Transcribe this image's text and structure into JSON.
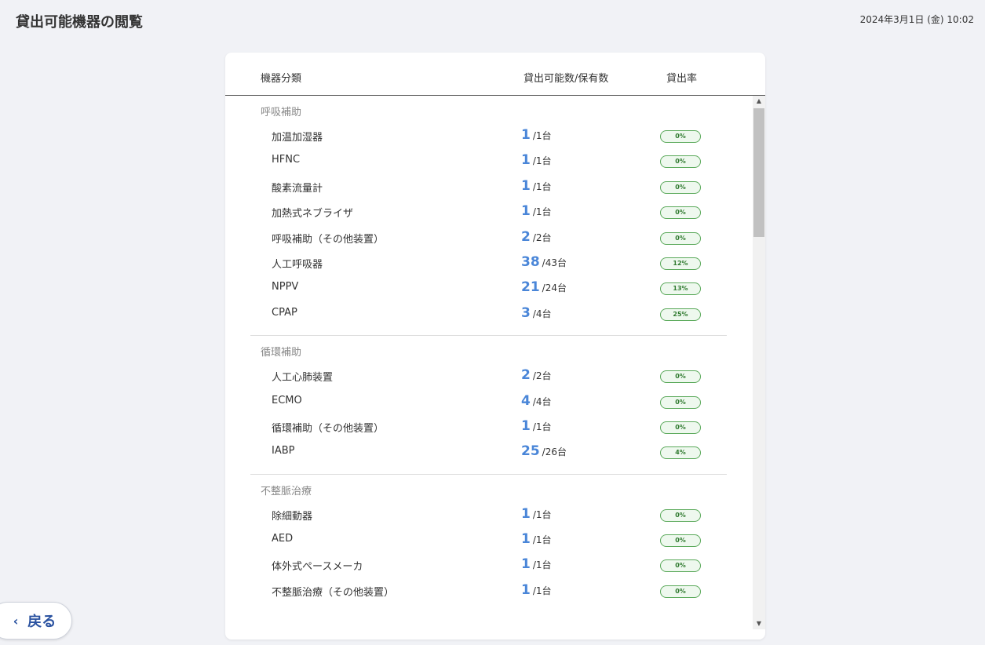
{
  "header": {
    "title": "貸出可能機器の閲覧",
    "datetime": "2024年3月1日 (金) 10:02"
  },
  "table": {
    "columns": {
      "category": "機器分類",
      "count": "貸出可能数/保有数",
      "rate": "貸出率"
    },
    "groups": [
      {
        "title": "呼吸補助",
        "items": [
          {
            "name": "加温加湿器",
            "available": "1",
            "total": "/1台",
            "rate": "0%"
          },
          {
            "name": "HFNC",
            "available": "1",
            "total": "/1台",
            "rate": "0%"
          },
          {
            "name": "酸素流量計",
            "available": "1",
            "total": "/1台",
            "rate": "0%"
          },
          {
            "name": "加熱式ネブライザ",
            "available": "1",
            "total": "/1台",
            "rate": "0%"
          },
          {
            "name": "呼吸補助（その他装置）",
            "available": "2",
            "total": "/2台",
            "rate": "0%"
          },
          {
            "name": "人工呼吸器",
            "available": "38",
            "total": "/43台",
            "rate": "12%"
          },
          {
            "name": "NPPV",
            "available": "21",
            "total": "/24台",
            "rate": "13%"
          },
          {
            "name": "CPAP",
            "available": "3",
            "total": "/4台",
            "rate": "25%"
          }
        ]
      },
      {
        "title": "循環補助",
        "items": [
          {
            "name": "人工心肺装置",
            "available": "2",
            "total": "/2台",
            "rate": "0%"
          },
          {
            "name": "ECMO",
            "available": "4",
            "total": "/4台",
            "rate": "0%"
          },
          {
            "name": "循環補助（その他装置）",
            "available": "1",
            "total": "/1台",
            "rate": "0%"
          },
          {
            "name": "IABP",
            "available": "25",
            "total": "/26台",
            "rate": "4%"
          }
        ]
      },
      {
        "title": "不整脈治療",
        "items": [
          {
            "name": "除細動器",
            "available": "1",
            "total": "/1台",
            "rate": "0%"
          },
          {
            "name": "AED",
            "available": "1",
            "total": "/1台",
            "rate": "0%"
          },
          {
            "name": "体外式ペースメーカ",
            "available": "1",
            "total": "/1台",
            "rate": "0%"
          },
          {
            "name": "不整脈治療（その他装置）",
            "available": "1",
            "total": "/1台",
            "rate": "0%"
          }
        ]
      }
    ]
  },
  "scrollbar": {
    "up_glyph": "▲",
    "down_glyph": "▼"
  },
  "back_button": {
    "chevron": "‹",
    "label": "戻る"
  }
}
